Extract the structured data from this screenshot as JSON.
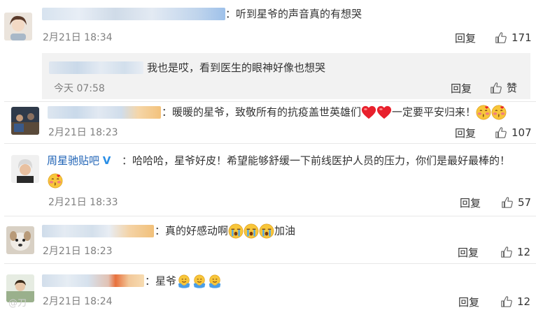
{
  "comments": [
    {
      "text": "：听到星爷的声音真的有想哭",
      "time": "2月21日 18:34",
      "reply_label": "回复",
      "likes": "171",
      "sub_reply": {
        "text": "我也是哎，看到医生的眼神好像也想哭",
        "time": "今天 07:58",
        "reply_label": "回复",
        "like_label": "赞"
      }
    },
    {
      "text": "：暖暖的星爷，致敬所有的抗疫盖世英雄们",
      "text_tail": "一定要平安归来！",
      "time": "2月21日 18:23",
      "reply_label": "回复",
      "likes": "107"
    },
    {
      "author": "周星驰贴吧",
      "verified": "V",
      "text": "：哈哈哈，星爷好皮！希望能够舒缓一下前线医护人员的压力，你们是最好最棒的！",
      "time": "2月21日 18:33",
      "reply_label": "回复",
      "likes": "57"
    },
    {
      "text": "：真的好感动啊",
      "text_tail": "加油",
      "time": "2月21日 18:23",
      "reply_label": "回复",
      "likes": "12"
    },
    {
      "text": "：星爷",
      "time": "2月21日 18:24",
      "reply_label": "回复",
      "likes": "12"
    }
  ],
  "watermark": "@刀",
  "icons": {
    "like": "thumbs-up-icon",
    "emoji": [
      "red-heart-icon",
      "blush-kiss-emoji-icon",
      "crying-emoji-icon",
      "hugging-emoji-icon"
    ]
  }
}
